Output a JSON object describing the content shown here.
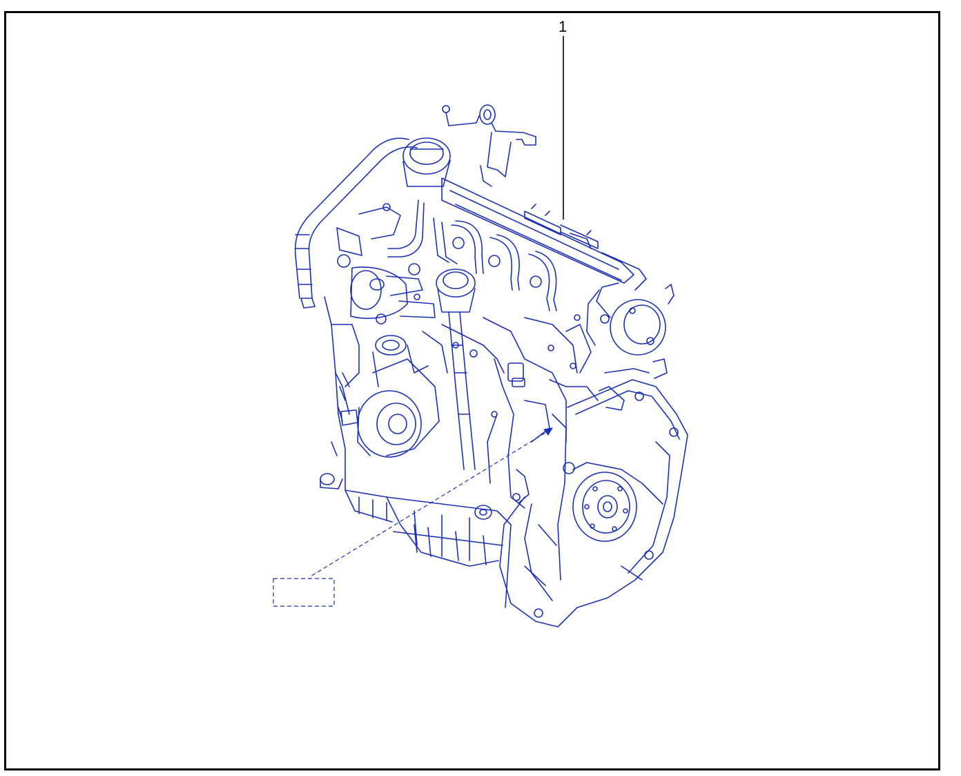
{
  "diagram": {
    "callouts": [
      {
        "number": "1"
      }
    ],
    "colors": {
      "linework": "#1a2fb5",
      "frame": "#000000",
      "leader": "#000000",
      "background": "#ffffff"
    },
    "icons": {
      "main_part": "engine-assembly-icon",
      "placeholder": "dashed-label-placeholder"
    }
  }
}
